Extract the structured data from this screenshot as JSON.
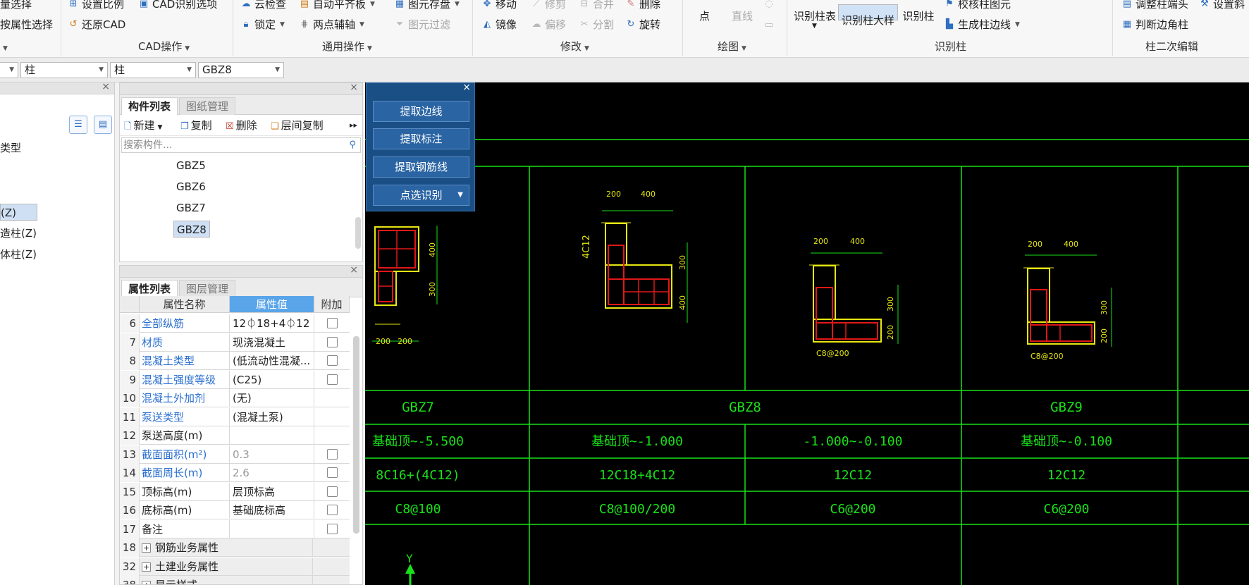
{
  "ribbon": {
    "items_row1": {
      "batch_select": "量选择",
      "set_scale": "设置比例",
      "cad_options": "CAD识别选项",
      "cloud_check": "云检查",
      "auto_align": "自动平齐板",
      "save_elements": "图元存盘",
      "move": "移动",
      "trim": "修剪",
      "merge": "合并",
      "delete": "删除",
      "point": "点",
      "line": "直线",
      "identify_col_table": "识别柱表",
      "identify_col_detail": "识别柱大样",
      "identify_col": "识别柱",
      "verify_col": "校核柱图元",
      "adjust_col_end": "调整柱端头",
      "set_oblique": "设置斜"
    },
    "items_row2": {
      "attr_select": "按属性选择",
      "restore_cad": "还原CAD",
      "lock": "锁定",
      "two_point_axis": "两点辅轴",
      "filter_elements": "图元过滤",
      "mirror": "镜像",
      "offset": "偏移",
      "split": "分割",
      "rotate": "旋转",
      "gen_col_edge": "生成柱边线",
      "judge_corner": "判断边角柱"
    },
    "groups": {
      "cad_ops": "CAD操作",
      "general_ops": "通用操作",
      "modify": "修改",
      "draw": "绘图",
      "identify_col": "识别柱",
      "col_secondary_edit": "柱二次编辑"
    }
  },
  "selectors": {
    "floor": "",
    "type1": "柱",
    "type2": "柱",
    "component": "GBZ8"
  },
  "left_tree": {
    "items": [
      "类型",
      "(Z)",
      "造柱(Z)",
      "体柱(Z)"
    ]
  },
  "component_list": {
    "tabs": [
      "构件列表",
      "图纸管理"
    ],
    "toolbar": {
      "new": "新建",
      "copy": "复制",
      "delete": "删除",
      "floor_copy": "层间复制"
    },
    "search_placeholder": "搜索构件...",
    "items": [
      "GBZ5",
      "GBZ6",
      "GBZ7",
      "GBZ8"
    ],
    "selected": "GBZ8"
  },
  "property_panel": {
    "tabs": [
      "属性列表",
      "图层管理"
    ],
    "headers": {
      "name": "属性名称",
      "value": "属性值",
      "extra": "附加"
    },
    "rows": [
      {
        "num": "6",
        "name": "全部纵筋",
        "value": "12⏀18+4⏀12",
        "blue": true,
        "check": true
      },
      {
        "num": "7",
        "name": "材质",
        "value": "现浇混凝土",
        "blue": true,
        "check": true
      },
      {
        "num": "8",
        "name": "混凝土类型",
        "value": "(低流动性混凝...",
        "blue": true,
        "check": true
      },
      {
        "num": "9",
        "name": "混凝土强度等级",
        "value": "(C25)",
        "blue": true,
        "check": true
      },
      {
        "num": "10",
        "name": "混凝土外加剂",
        "value": "(无)",
        "blue": true,
        "check": false
      },
      {
        "num": "11",
        "name": "泵送类型",
        "value": "(混凝土泵)",
        "blue": true,
        "check": false
      },
      {
        "num": "12",
        "name": "泵送高度(m)",
        "value": "",
        "blue": false,
        "check": false
      },
      {
        "num": "13",
        "name": "截面面积(m²)",
        "value": "0.3",
        "blue": true,
        "check": true,
        "gray": true
      },
      {
        "num": "14",
        "name": "截面周长(m)",
        "value": "2.6",
        "blue": true,
        "check": true,
        "gray": true
      },
      {
        "num": "15",
        "name": "顶标高(m)",
        "value": "层顶标高",
        "blue": false,
        "check": true
      },
      {
        "num": "16",
        "name": "底标高(m)",
        "value": "基础底标高",
        "blue": false,
        "check": true
      },
      {
        "num": "17",
        "name": "备注",
        "value": "",
        "blue": false,
        "check": true
      },
      {
        "num": "18",
        "name": "钢筋业务属性",
        "group": true
      },
      {
        "num": "32",
        "name": "土建业务属性",
        "group": true
      },
      {
        "num": "38",
        "name": "显示样式",
        "group": true
      }
    ]
  },
  "float_panel": {
    "buttons": [
      "提取边线",
      "提取标注",
      "提取钢筋线",
      "点选识别"
    ]
  },
  "cad": {
    "dims": {
      "gbz7_top": "400",
      "gbz7_bottom": "300",
      "gbz7_w1": "200",
      "gbz7_w2": "200",
      "gbz8a_w1": "200",
      "gbz8a_w2": "400",
      "gbz8a_side": "4C12",
      "gbz8a_h1": "300",
      "gbz8a_h2": "400",
      "gbz8b_w1": "200",
      "gbz8b_w2": "400",
      "gbz8b_h1": "300",
      "gbz8b_h2": "200",
      "gbz8b_stirrup": "C8@200",
      "gbz9_w1": "200",
      "gbz9_w2": "400",
      "gbz9_h1": "300",
      "gbz9_h2": "200",
      "gbz9_stirrup": "C8@200"
    },
    "table": {
      "row_names": [
        "GBZ7",
        "GBZ8",
        "GBZ9"
      ],
      "elev": [
        "基础顶~-5.500",
        "基础顶~-1.000",
        "-1.000~-0.100",
        "基础顶~-0.100"
      ],
      "bars": [
        "8C16+(4C12)",
        "12C18+4C12",
        "12C12",
        "12C12"
      ],
      "stirrups": [
        "C8@100",
        "C8@100/200",
        "C6@200",
        "C6@200"
      ]
    },
    "axis_label": "Y"
  }
}
